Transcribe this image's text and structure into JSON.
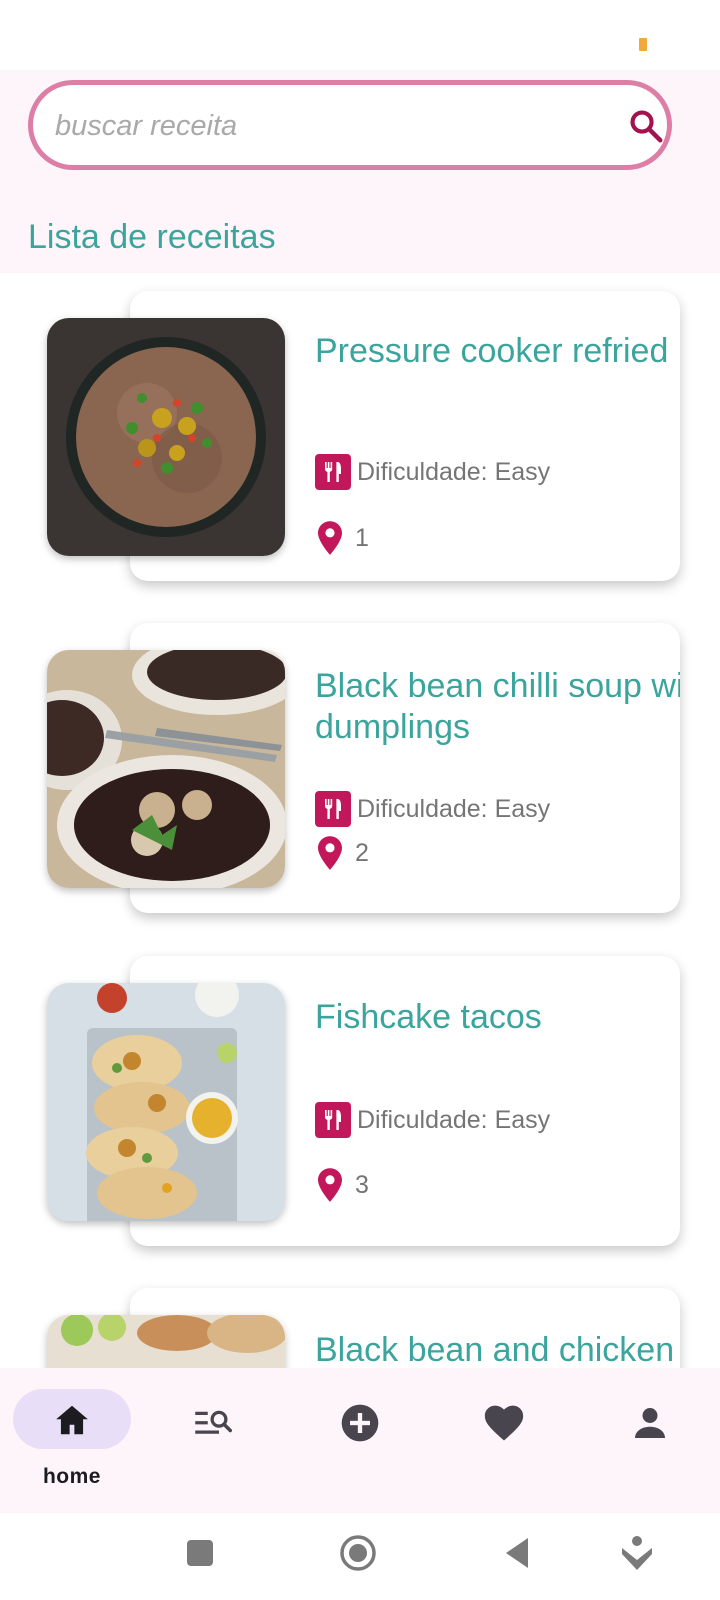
{
  "search": {
    "placeholder": "buscar receita",
    "value": ""
  },
  "section_title": "Lista de receitas",
  "recipes": [
    {
      "title": "Pressure cooker refried beans",
      "difficulty_label": "Dificuldade: Easy",
      "id": "1"
    },
    {
      "title": "Black bean chilli soup with dumplings",
      "difficulty_label": "Dificuldade: Easy",
      "id": "2"
    },
    {
      "title": "Fishcake tacos",
      "difficulty_label": "Dificuldade: Easy",
      "id": "3"
    },
    {
      "title": "Black bean and chicken burritos",
      "difficulty_label": "",
      "id": ""
    }
  ],
  "nav": {
    "items": [
      {
        "label": "home",
        "icon": "home-icon",
        "active": true
      },
      {
        "label": "",
        "icon": "search-list-icon",
        "active": false
      },
      {
        "label": "",
        "icon": "add-circle-icon",
        "active": false
      },
      {
        "label": "",
        "icon": "heart-icon",
        "active": false
      },
      {
        "label": "",
        "icon": "person-icon",
        "active": false
      }
    ]
  },
  "colors": {
    "accent_teal": "#3ba59d",
    "accent_magenta": "#c2185b",
    "search_border": "#dd7ea7",
    "nav_background": "#fdf5f9",
    "nav_active_pill": "#e8def8"
  }
}
